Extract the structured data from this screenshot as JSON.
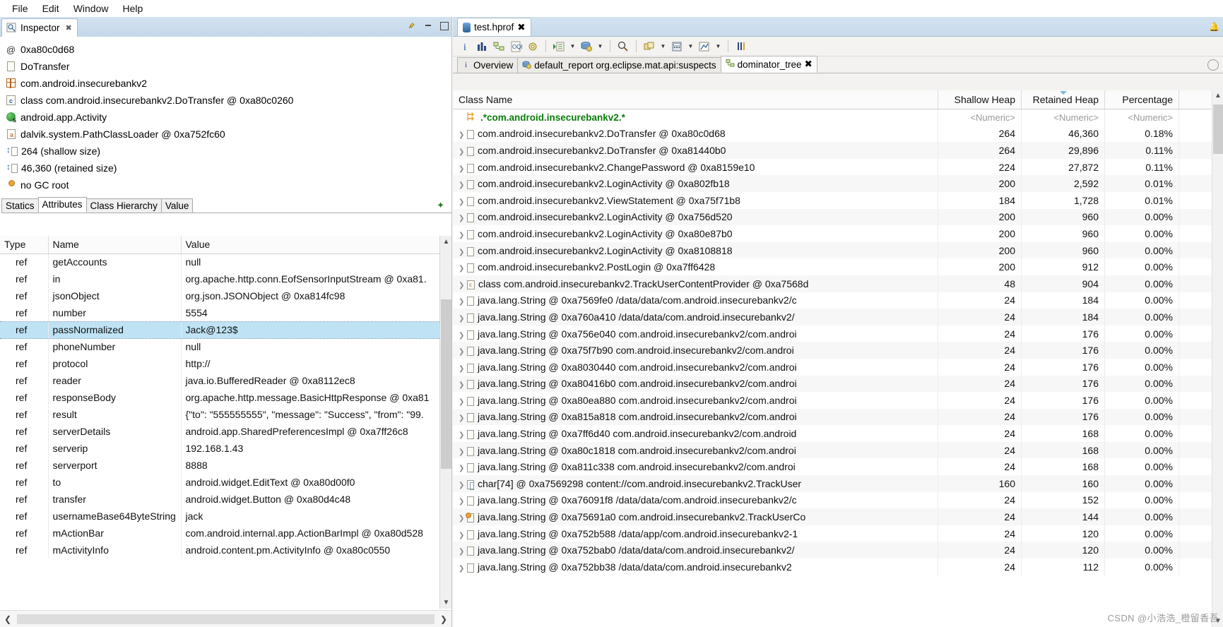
{
  "menubar": {
    "items": [
      "File",
      "Edit",
      "Window",
      "Help"
    ]
  },
  "inspector": {
    "tab_label": "Inspector",
    "tab_close": "✖",
    "rows": [
      {
        "icon": "at-icon",
        "text": "0xa80c0d68"
      },
      {
        "icon": "document-icon",
        "text": "DoTransfer"
      },
      {
        "icon": "package-icon",
        "text": "com.android.insecurebankv2"
      },
      {
        "icon": "class-icon",
        "text": "class com.android.insecurebankv2.DoTransfer @ 0xa80c0260"
      },
      {
        "icon": "superclass-icon",
        "text": "android.app.Activity"
      },
      {
        "icon": "classloader-icon",
        "text": "dalvik.system.PathClassLoader @ 0xa752fc60"
      },
      {
        "icon": "shallow-size-icon",
        "text": "264 (shallow size)"
      },
      {
        "icon": "retained-size-icon",
        "text": "46,360 (retained size)"
      },
      {
        "icon": "gc-root-icon",
        "text": "no GC root"
      }
    ],
    "subtabs": [
      "Statics",
      "Attributes",
      "Class Hierarchy",
      "Value"
    ],
    "active_subtab": "Attributes",
    "table": {
      "columns": [
        "Type",
        "Name",
        "Value"
      ],
      "rows": [
        {
          "type": "ref",
          "name": "getAccounts",
          "value": "null"
        },
        {
          "type": "ref",
          "name": "in",
          "value": "org.apache.http.conn.EofSensorInputStream @ 0xa81."
        },
        {
          "type": "ref",
          "name": "jsonObject",
          "value": "org.json.JSONObject @ 0xa814fc98"
        },
        {
          "type": "ref",
          "name": "number",
          "value": "5554"
        },
        {
          "type": "ref",
          "name": "passNormalized",
          "value": "Jack@123$",
          "selected": true
        },
        {
          "type": "ref",
          "name": "phoneNumber",
          "value": "null"
        },
        {
          "type": "ref",
          "name": "protocol",
          "value": "http://"
        },
        {
          "type": "ref",
          "name": "reader",
          "value": "java.io.BufferedReader @ 0xa8112ec8"
        },
        {
          "type": "ref",
          "name": "responseBody",
          "value": "org.apache.http.message.BasicHttpResponse @ 0xa81"
        },
        {
          "type": "ref",
          "name": "result",
          "value": "{\"to\": \"555555555\", \"message\": \"Success\", \"from\": \"99."
        },
        {
          "type": "ref",
          "name": "serverDetails",
          "value": "android.app.SharedPreferencesImpl @ 0xa7ff26c8"
        },
        {
          "type": "ref",
          "name": "serverip",
          "value": "192.168.1.43"
        },
        {
          "type": "ref",
          "name": "serverport",
          "value": "8888"
        },
        {
          "type": "ref",
          "name": "to",
          "value": "android.widget.EditText @ 0xa80d00f0"
        },
        {
          "type": "ref",
          "name": "transfer",
          "value": "android.widget.Button @ 0xa80d4c48"
        },
        {
          "type": "ref",
          "name": "usernameBase64ByteString",
          "value": "jack"
        },
        {
          "type": "ref",
          "name": "mActionBar",
          "value": "com.android.internal.app.ActionBarImpl @ 0xa80d528"
        },
        {
          "type": "ref",
          "name": "mActivityInfo",
          "value": "android.content.pm.ActivityInfo @ 0xa80c0550"
        }
      ]
    }
  },
  "editor": {
    "tab_label": "test.hprof",
    "tab_close": "✖",
    "toolbar_icons": [
      "info-icon",
      "histogram-icon",
      "dominator-tree-icon",
      "oql-icon",
      "query-browser-icon",
      "group-by-icon",
      "inspections-icon",
      "search-icon",
      "compare-icon",
      "calculator-icon",
      "export-icon",
      "thread-overview-icon"
    ],
    "inner_tabs": [
      {
        "label": "Overview",
        "icon": "info-icon",
        "active": false,
        "closable": false
      },
      {
        "label": "default_report  org.eclipse.mat.api:suspects",
        "icon": "report-icon",
        "active": false,
        "closable": false
      },
      {
        "label": "dominator_tree",
        "icon": "dominator-tree-icon",
        "active": true,
        "closable": true,
        "close": "✖"
      }
    ]
  },
  "dominator_tree": {
    "columns": [
      "Class Name",
      "Shallow Heap",
      "Retained Heap",
      "Percentage"
    ],
    "filter_row": {
      "class_name": ".*com.android.insecurebankv2.*",
      "shallow": "<Numeric>",
      "retained": "<Numeric>",
      "percentage": "<Numeric>"
    },
    "rows": [
      {
        "icon": "object-icon",
        "name": "com.android.insecurebankv2.DoTransfer @ 0xa80c0d68",
        "shallow": "264",
        "retained": "46,360",
        "pct": "0.18%"
      },
      {
        "icon": "object-icon",
        "name": "com.android.insecurebankv2.DoTransfer @ 0xa81440b0",
        "shallow": "264",
        "retained": "29,896",
        "pct": "0.11%"
      },
      {
        "icon": "object-icon",
        "name": "com.android.insecurebankv2.ChangePassword @ 0xa8159e10",
        "shallow": "224",
        "retained": "27,872",
        "pct": "0.11%"
      },
      {
        "icon": "object-icon",
        "name": "com.android.insecurebankv2.LoginActivity @ 0xa802fb18",
        "shallow": "200",
        "retained": "2,592",
        "pct": "0.01%"
      },
      {
        "icon": "object-icon",
        "name": "com.android.insecurebankv2.ViewStatement @ 0xa75f71b8",
        "shallow": "184",
        "retained": "1,728",
        "pct": "0.01%"
      },
      {
        "icon": "object-icon",
        "name": "com.android.insecurebankv2.LoginActivity @ 0xa756d520",
        "shallow": "200",
        "retained": "960",
        "pct": "0.00%"
      },
      {
        "icon": "object-icon",
        "name": "com.android.insecurebankv2.LoginActivity @ 0xa80e87b0",
        "shallow": "200",
        "retained": "960",
        "pct": "0.00%"
      },
      {
        "icon": "object-icon",
        "name": "com.android.insecurebankv2.LoginActivity @ 0xa8108818",
        "shallow": "200",
        "retained": "960",
        "pct": "0.00%"
      },
      {
        "icon": "object-icon",
        "name": "com.android.insecurebankv2.PostLogin @ 0xa7ff6428",
        "shallow": "200",
        "retained": "912",
        "pct": "0.00%"
      },
      {
        "icon": "class-icon",
        "name": "class com.android.insecurebankv2.TrackUserContentProvider @ 0xa7568d",
        "shallow": "48",
        "retained": "904",
        "pct": "0.00%"
      },
      {
        "icon": "object-icon",
        "name": "java.lang.String @ 0xa7569fe0  /data/data/com.android.insecurebankv2/c",
        "shallow": "24",
        "retained": "184",
        "pct": "0.00%"
      },
      {
        "icon": "object-icon",
        "name": "java.lang.String @ 0xa760a410  /data/data/com.android.insecurebankv2/",
        "shallow": "24",
        "retained": "184",
        "pct": "0.00%"
      },
      {
        "icon": "object-icon",
        "name": "java.lang.String @ 0xa756e040  com.android.insecurebankv2/com.androi",
        "shallow": "24",
        "retained": "176",
        "pct": "0.00%"
      },
      {
        "icon": "object-icon",
        "name": "java.lang.String @ 0xa75f7b90  com.android.insecurebankv2/com.androi",
        "shallow": "24",
        "retained": "176",
        "pct": "0.00%"
      },
      {
        "icon": "object-icon",
        "name": "java.lang.String @ 0xa8030440  com.android.insecurebankv2/com.androi",
        "shallow": "24",
        "retained": "176",
        "pct": "0.00%"
      },
      {
        "icon": "object-icon",
        "name": "java.lang.String @ 0xa80416b0  com.android.insecurebankv2/com.androi",
        "shallow": "24",
        "retained": "176",
        "pct": "0.00%"
      },
      {
        "icon": "object-icon",
        "name": "java.lang.String @ 0xa80ea880  com.android.insecurebankv2/com.androi",
        "shallow": "24",
        "retained": "176",
        "pct": "0.00%"
      },
      {
        "icon": "object-icon",
        "name": "java.lang.String @ 0xa815a818  com.android.insecurebankv2/com.androi",
        "shallow": "24",
        "retained": "176",
        "pct": "0.00%"
      },
      {
        "icon": "object-icon",
        "name": "java.lang.String @ 0xa7ff6d40  com.android.insecurebankv2/com.android",
        "shallow": "24",
        "retained": "168",
        "pct": "0.00%"
      },
      {
        "icon": "object-icon",
        "name": "java.lang.String @ 0xa80c1818  com.android.insecurebankv2/com.androi",
        "shallow": "24",
        "retained": "168",
        "pct": "0.00%"
      },
      {
        "icon": "object-icon",
        "name": "java.lang.String @ 0xa811c338  com.android.insecurebankv2/com.androi",
        "shallow": "24",
        "retained": "168",
        "pct": "0.00%"
      },
      {
        "icon": "array-icon",
        "name": "char[74] @ 0xa7569298  content://com.android.insecurebankv2.TrackUser",
        "shallow": "160",
        "retained": "160",
        "pct": "0.00%"
      },
      {
        "icon": "object-icon",
        "name": "java.lang.String @ 0xa76091f8  /data/data/com.android.insecurebankv2/c",
        "shallow": "24",
        "retained": "152",
        "pct": "0.00%"
      },
      {
        "icon": "gc-root-icon",
        "name": "java.lang.String @ 0xa75691a0  com.android.insecurebankv2.TrackUserCo",
        "shallow": "24",
        "retained": "144",
        "pct": "0.00%"
      },
      {
        "icon": "object-icon",
        "name": "java.lang.String @ 0xa752b588  /data/app/com.android.insecurebankv2-1",
        "shallow": "24",
        "retained": "120",
        "pct": "0.00%"
      },
      {
        "icon": "object-icon",
        "name": "java.lang.String @ 0xa752bab0  /data/data/com.android.insecurebankv2/",
        "shallow": "24",
        "retained": "120",
        "pct": "0.00%"
      },
      {
        "icon": "object-icon",
        "name": "java.lang.String @ 0xa752bb38  /data/data/com.android.insecurebankv2",
        "shallow": "24",
        "retained": "112",
        "pct": "0.00%"
      }
    ]
  },
  "watermark": "CSDN @小浩浩_橙留香吾"
}
